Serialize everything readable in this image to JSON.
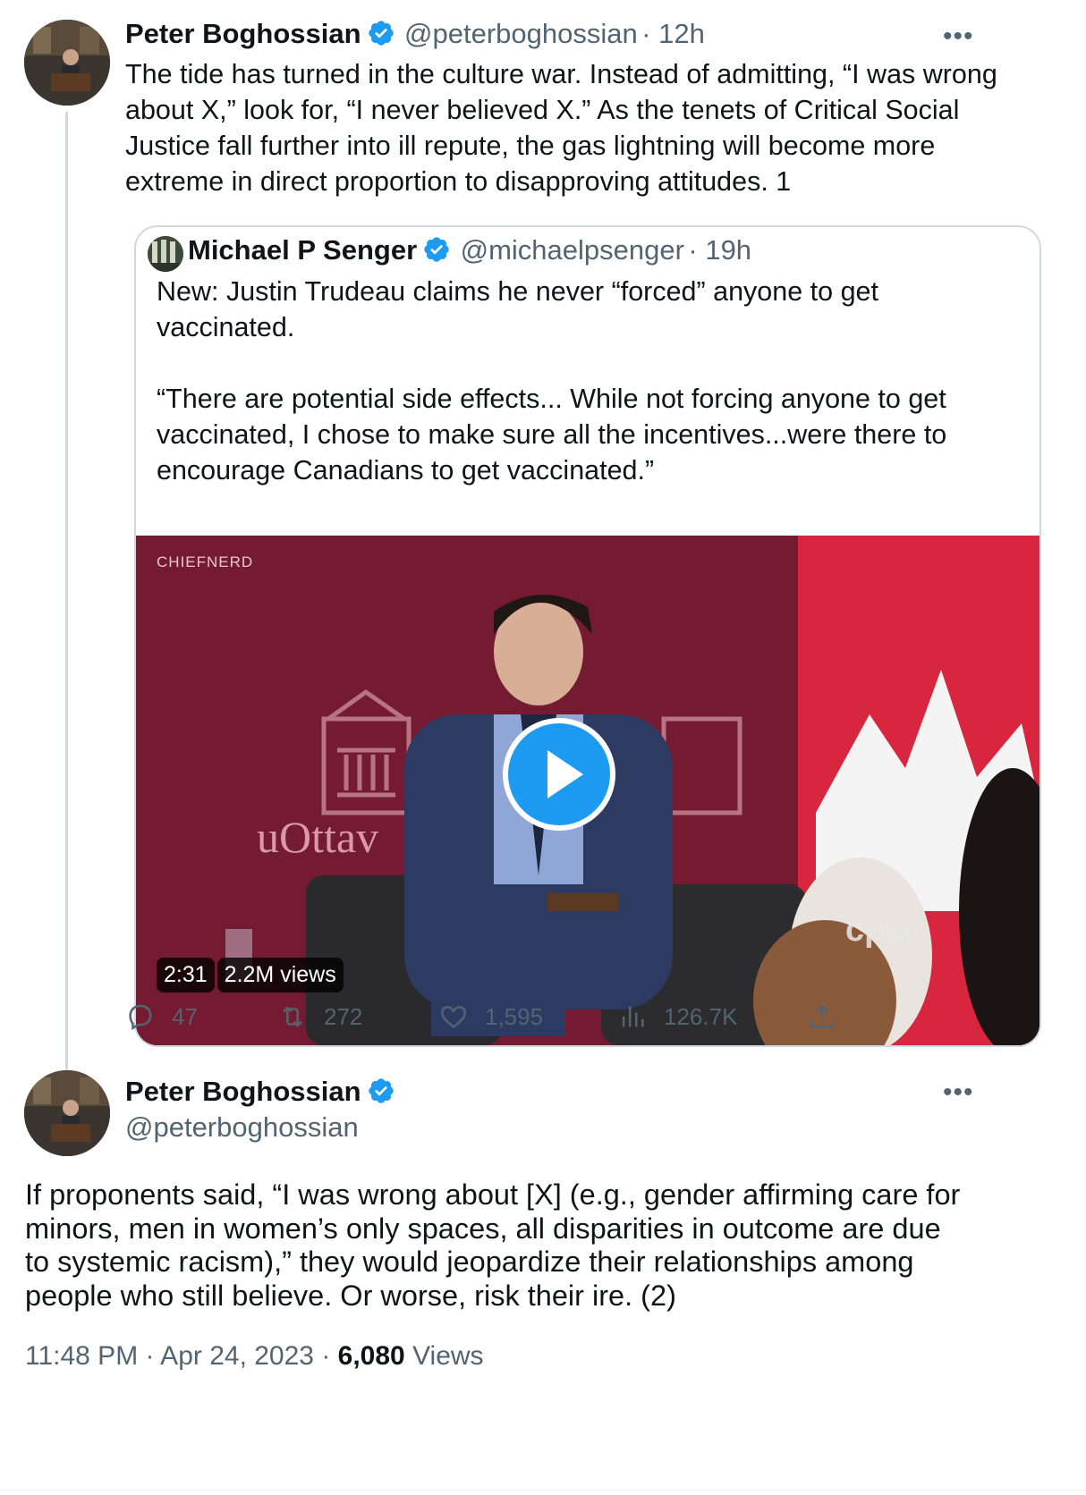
{
  "tweet1": {
    "author_name": "Peter Boghossian",
    "handle": "@peterboghossian",
    "time": "· 12h",
    "more": "•••",
    "text": "The tide has turned in the culture war. Instead of admitting, “I was wrong\nabout X,” look for, “I never believed X.” As the tenets of Critical Social\nJustice fall further into ill repute, the gas lightning will become more\nextreme in direct proportion to disapproving attitudes. 1"
  },
  "quote": {
    "author_name": "Michael P Senger",
    "handle": "@michaelpsenger",
    "time": "· 19h",
    "text": "New: Justin Trudeau claims he never “forced” anyone to get\nvaccinated.\n\n“There are potential side effects... While not forcing anyone to get\nvaccinated, I chose to make sure all the incentives...were there to\nencourage Canadians to get vaccinated.”",
    "video": {
      "watermark": "CHIEFNERD",
      "backdrop_text": "uOttav",
      "logo": "cpac",
      "duration": "2:31",
      "views": "2.2M views"
    }
  },
  "actions": {
    "replies": "47",
    "retweets": "272",
    "likes": "1,595",
    "views": "126.7K"
  },
  "tweet2": {
    "author_name": "Peter Boghossian",
    "handle": "@peterboghossian",
    "more": "•••",
    "text": "If proponents said, “I was wrong about [X] (e.g., gender affirming care for\nminors, men in women’s only spaces, all disparities in outcome are due\nto systemic racism),” they would jeopardize their relationships among\npeople who still believe. Or worse, risk their ire. (2)",
    "timestamp": "11:48 PM · Apr 24, 2023 · ",
    "view_count": "6,080",
    "views_label": " Views"
  },
  "colors": {
    "verified": "#1d9bf0",
    "play_button": "#1d9bf0",
    "media_bg": "#7a1d34",
    "secondary_text": "#536471"
  },
  "icons": [
    "verified-badge-icon",
    "more-options-icon",
    "reply-icon",
    "retweet-icon",
    "like-icon",
    "views-icon",
    "share-icon",
    "play-icon"
  ]
}
